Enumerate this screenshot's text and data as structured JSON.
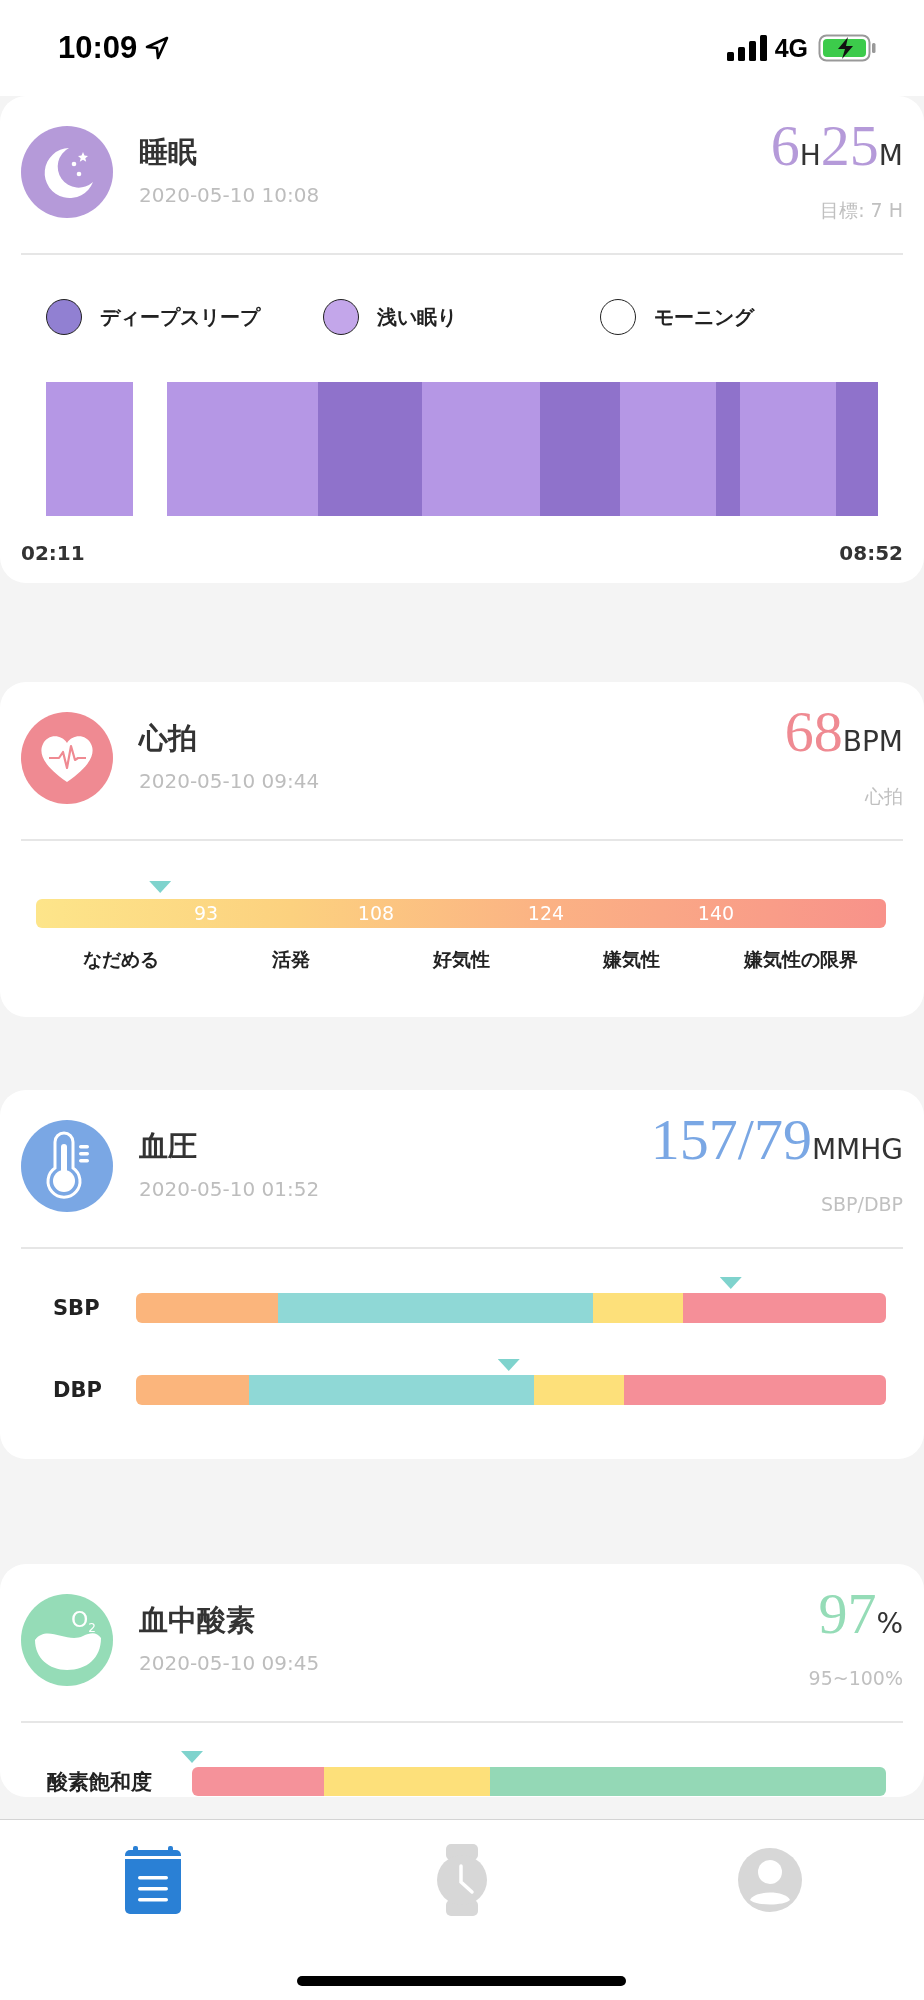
{
  "status_bar": {
    "time": "10:09",
    "network": "4G"
  },
  "cards": [
    {
      "kind": "sleep",
      "color": "#b59ad9",
      "title": "睡眠",
      "date": "2020-05-10 10:08",
      "reading": [
        {
          "kind": "number",
          "text": "6"
        },
        {
          "kind": "unit",
          "text": "H"
        },
        {
          "kind": "number",
          "text": "25"
        },
        {
          "kind": "unit",
          "text": "M"
        }
      ],
      "sub": "目標: 7 H",
      "legend": [
        {
          "label": "ディープスリープ",
          "color": "#9180d2"
        },
        {
          "label": "浅い眠り",
          "color": "#c3a6ea"
        },
        {
          "label": "モーニング",
          "color": "#ffffff"
        }
      ],
      "segments": [
        {
          "kind": "light"
        },
        {
          "kind": "awake"
        },
        {
          "kind": "light"
        },
        {
          "kind": "deep"
        },
        {
          "kind": "light"
        },
        {
          "kind": "deep"
        },
        {
          "kind": "light"
        },
        {
          "kind": "deep"
        },
        {
          "kind": "light"
        },
        {
          "kind": "deep"
        }
      ],
      "start_time": "02:11",
      "end_time": "08:52"
    },
    {
      "kind": "heart",
      "color": "#ef8a92",
      "title": "心拍",
      "date": "2020-05-10 09:44",
      "reading": [
        {
          "kind": "number",
          "text": "68"
        },
        {
          "kind": "unit",
          "text": "BPM"
        }
      ],
      "sub": "心拍",
      "marker": {
        "level": 0.15
      },
      "thresholds": [
        "93",
        "108",
        "124",
        "140"
      ],
      "zones": [
        "なだめる",
        "活発",
        "好気性",
        "嫌気性",
        "嫌気性の限界"
      ]
    },
    {
      "kind": "bp",
      "color": "#7aa7e4",
      "title": "血圧",
      "date": "2020-05-10 01:52",
      "reading": [
        {
          "kind": "number",
          "text": "157/79"
        },
        {
          "kind": "unit",
          "text": "MMHG"
        }
      ],
      "sub": "SBP/DBP",
      "bars": [
        {
          "label": "SBP",
          "marker": {
            "level": 0.817
          },
          "segments": [
            {
              "color": "#fbb57c"
            },
            {
              "color": "#8fd8d6"
            },
            {
              "color": "#fde07a"
            },
            {
              "color": "#f58f98"
            }
          ]
        },
        {
          "label": "DBP",
          "marker": {
            "level": 0.512
          },
          "segments": [
            {
              "color": "#fbb57c"
            },
            {
              "color": "#8fd8d6"
            },
            {
              "color": "#fde07a"
            },
            {
              "color": "#f58f98"
            }
          ]
        }
      ]
    },
    {
      "kind": "o2",
      "color": "#95dcb7",
      "title": "血中酸素",
      "date": "2020-05-10 09:45",
      "reading": [
        {
          "kind": "number",
          "text": "97"
        },
        {
          "kind": "unit",
          "text": "%"
        }
      ],
      "sub": "95~100%",
      "icon_text": "O$_{2}$",
      "bars": [
        {
          "label": "酸素飽和度",
          "segments": [
            {
              "color": "#f5929a"
            },
            {
              "color": "#fde07a"
            },
            {
              "color": "#94d8b6"
            }
          ]
        }
      ]
    }
  ],
  "tabs": [
    {
      "kind": "journal",
      "selected": true
    },
    {
      "kind": "watch",
      "selected": false
    },
    {
      "kind": "profile",
      "selected": false
    }
  ]
}
